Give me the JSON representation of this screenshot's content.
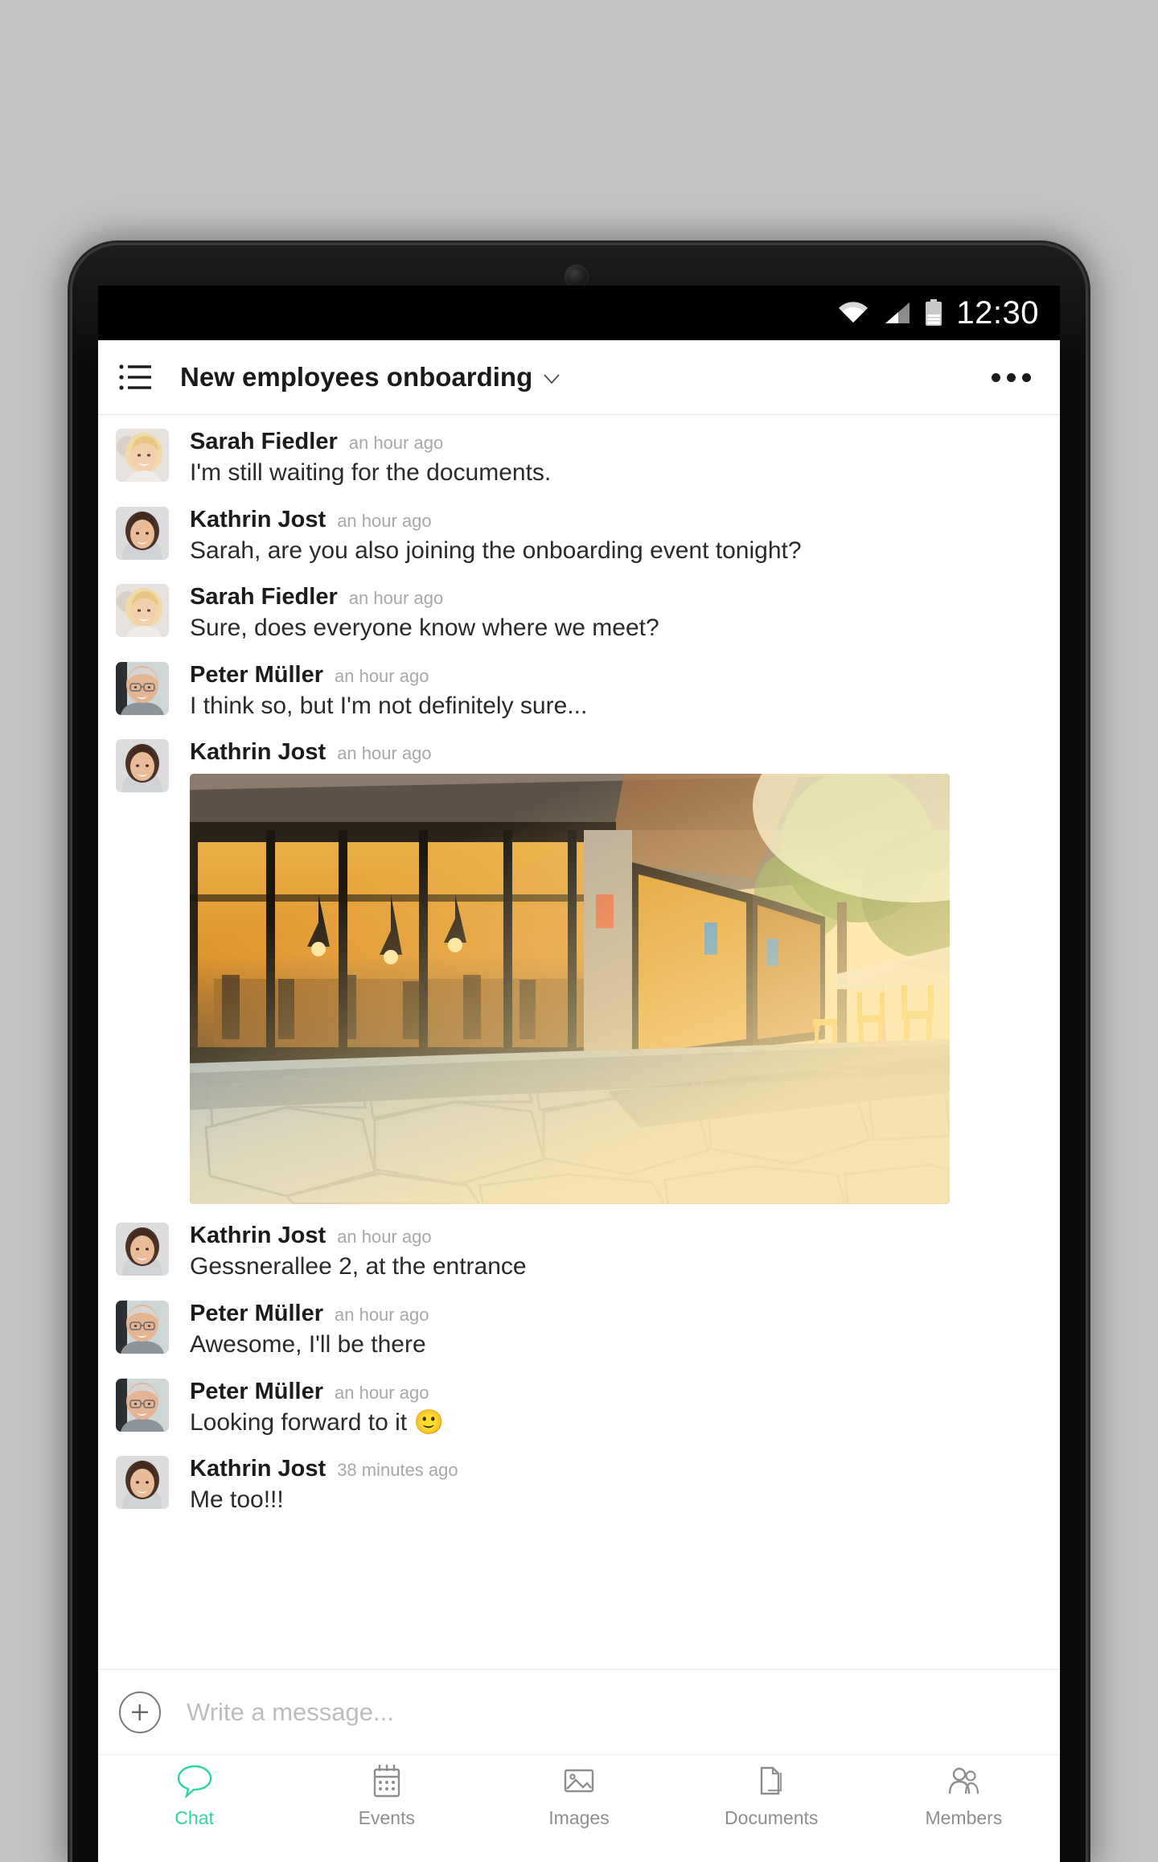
{
  "statusbar": {
    "time": "12:30",
    "icons": [
      "wifi-icon",
      "cellular-signal-icon",
      "battery-icon"
    ]
  },
  "header": {
    "menu_icon": "list-icon",
    "title": "New employees onboarding",
    "chevron_icon": "chevron-down-icon",
    "overflow_icon": "overflow-menu-icon"
  },
  "messages": [
    {
      "author": "Sarah Fiedler",
      "time": "an hour ago",
      "text": "I'm still waiting for the documents.",
      "avatar": "sarah",
      "type": "text"
    },
    {
      "author": "Kathrin Jost",
      "time": "an hour ago",
      "text": "Sarah, are you also joining the onboarding event tonight?",
      "avatar": "kathrin",
      "type": "text"
    },
    {
      "author": "Sarah Fiedler",
      "time": "an hour ago",
      "text": "Sure, does everyone know where we meet?",
      "avatar": "sarah",
      "type": "text"
    },
    {
      "author": "Peter Müller",
      "time": "an hour ago",
      "text": "I think so, but I'm not definitely sure...",
      "avatar": "peter",
      "type": "text"
    },
    {
      "author": "Kathrin Jost",
      "time": "an hour ago",
      "text": "",
      "avatar": "kathrin",
      "type": "photo",
      "photo_alt": "Restaurant storefront at sunset with outdoor stone pavement and yellow chairs"
    },
    {
      "author": "Kathrin Jost",
      "time": "an hour ago",
      "text": "Gessnerallee 2, at the entrance",
      "avatar": "kathrin",
      "type": "text"
    },
    {
      "author": "Peter Müller",
      "time": "an hour ago",
      "text": "Awesome, I'll be there",
      "avatar": "peter",
      "type": "text"
    },
    {
      "author": "Peter Müller",
      "time": "an hour ago",
      "text": "Looking forward to it 🙂",
      "avatar": "peter",
      "type": "text"
    },
    {
      "author": "Kathrin Jost",
      "time": "38 minutes ago",
      "text": "Me too!!!",
      "avatar": "kathrin",
      "type": "text"
    }
  ],
  "composer": {
    "attach_icon": "plus-circle-icon",
    "attach_label": "+",
    "placeholder": "Write a message...",
    "value": ""
  },
  "bottom_nav": {
    "active": "Chat",
    "items": [
      {
        "label": "Chat",
        "icon": "chat-bubble-icon"
      },
      {
        "label": "Events",
        "icon": "calendar-icon"
      },
      {
        "label": "Images",
        "icon": "image-icon"
      },
      {
        "label": "Documents",
        "icon": "documents-icon"
      },
      {
        "label": "Members",
        "icon": "members-icon"
      }
    ]
  },
  "colors": {
    "accent": "#2ed698",
    "page_background": "#c3c3c3",
    "device_body": "#0c0c0c",
    "statusbar_background": "#000000",
    "text_primary": "#1b1b1b",
    "text_muted": "#a8a8a8",
    "placeholder": "#bdbdbd"
  }
}
